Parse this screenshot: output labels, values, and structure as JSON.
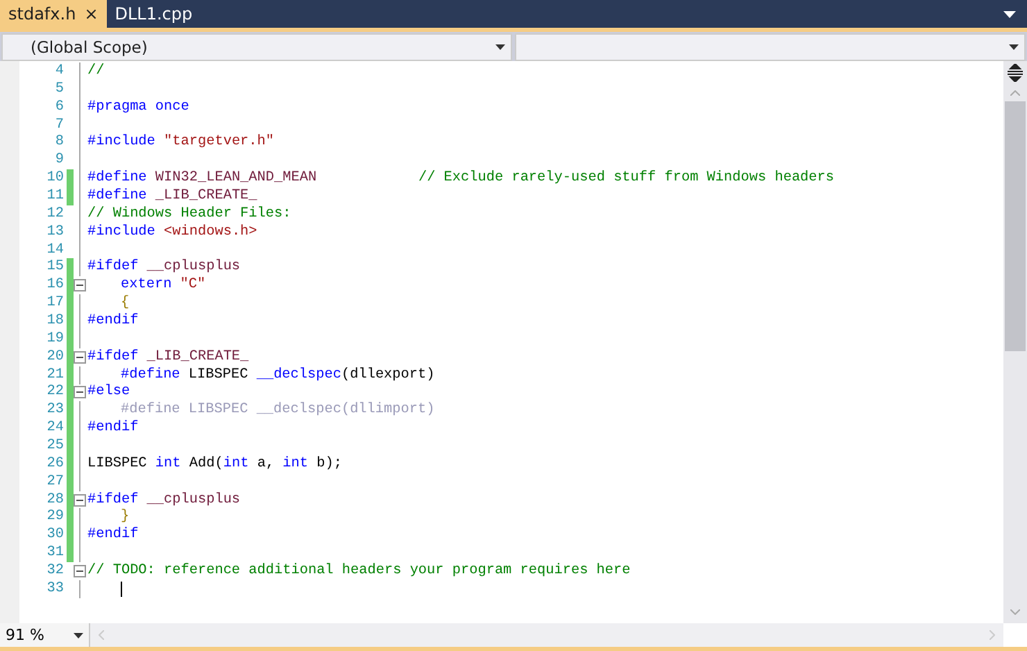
{
  "tabs": [
    {
      "label": "stdafx.h",
      "selected": true,
      "close": "×"
    },
    {
      "label": "DLL1.cpp",
      "selected": false
    }
  ],
  "navigation": {
    "scope": "(Global Scope)"
  },
  "lines": [
    {
      "number": "4",
      "changed": false,
      "collapsible": false,
      "tokens": [
        {
          "text": "//",
          "kind": "comment"
        }
      ]
    },
    {
      "number": "5",
      "changed": false,
      "collapsible": false
    },
    {
      "number": "6",
      "changed": false,
      "collapsible": false,
      "tokens": [
        {
          "text": "#pragma ",
          "kind": "preproc"
        },
        {
          "text": "once",
          "kind": "keyword"
        }
      ]
    },
    {
      "number": "7",
      "changed": false,
      "collapsible": false
    },
    {
      "number": "8",
      "changed": false,
      "collapsible": false,
      "tokens": [
        {
          "text": "#include ",
          "kind": "preproc"
        },
        {
          "text": "\"targetver.h\"",
          "kind": "string"
        }
      ]
    },
    {
      "number": "9",
      "changed": false,
      "collapsible": false
    },
    {
      "number": "10",
      "changed": true,
      "collapsible": false,
      "tokens": [
        {
          "text": "#define ",
          "kind": "preproc"
        },
        {
          "text": "WIN32_LEAN_AND_MEAN            ",
          "kind": "macro"
        },
        {
          "text": "// Exclude rarely-used stuff from Windows headers",
          "kind": "comment"
        }
      ]
    },
    {
      "number": "11",
      "changed": true,
      "collapsible": false,
      "tokens": [
        {
          "text": "#define ",
          "kind": "preproc"
        },
        {
          "text": "_LIB_CREATE_",
          "kind": "macro"
        }
      ]
    },
    {
      "number": "12",
      "changed": false,
      "collapsible": false,
      "tokens": [
        {
          "text": "// Windows Header Files:",
          "kind": "comment"
        }
      ]
    },
    {
      "number": "13",
      "changed": false,
      "collapsible": false,
      "tokens": [
        {
          "text": "#include ",
          "kind": "preproc"
        },
        {
          "text": "<windows.h>",
          "kind": "string"
        }
      ]
    },
    {
      "number": "14",
      "changed": false,
      "collapsible": false
    },
    {
      "number": "15",
      "changed": true,
      "collapsible": false,
      "tokens": [
        {
          "text": "#ifdef ",
          "kind": "preproc"
        },
        {
          "text": "__cplusplus",
          "kind": "macro"
        }
      ]
    },
    {
      "number": "16",
      "changed": true,
      "collapsible": true,
      "indented": true,
      "tokens": [
        {
          "text": "extern ",
          "kind": "keyword"
        },
        {
          "text": "\"C\"",
          "kind": "string"
        }
      ]
    },
    {
      "number": "17",
      "changed": true,
      "collapsible": false,
      "indented": true,
      "tokens": [
        {
          "text": "{",
          "kind": "brace"
        }
      ]
    },
    {
      "number": "18",
      "changed": true,
      "collapsible": false,
      "tokens": [
        {
          "text": "#endif",
          "kind": "preproc"
        }
      ]
    },
    {
      "number": "19",
      "changed": true,
      "collapsible": false
    },
    {
      "number": "20",
      "changed": true,
      "collapsible": true,
      "tokens": [
        {
          "text": "#ifdef ",
          "kind": "preproc"
        },
        {
          "text": "_LIB_CREATE_",
          "kind": "macro"
        }
      ]
    },
    {
      "number": "21",
      "changed": true,
      "collapsible": false,
      "indented": true,
      "tokens": [
        {
          "text": "#define ",
          "kind": "preproc"
        },
        {
          "text": "LIBSPEC ",
          "kind": "plain"
        },
        {
          "text": "__declspec",
          "kind": "keyword"
        },
        {
          "text": "(dllexport)",
          "kind": "plain"
        }
      ]
    },
    {
      "number": "22",
      "changed": true,
      "collapsible": true,
      "tokens": [
        {
          "text": "#else",
          "kind": "preproc"
        }
      ]
    },
    {
      "number": "23",
      "changed": true,
      "collapsible": false,
      "indented": true,
      "tokens": [
        {
          "text": "#define LIBSPEC __declspec(dllimport)",
          "kind": "inactive"
        }
      ]
    },
    {
      "number": "24",
      "changed": true,
      "collapsible": false,
      "tokens": [
        {
          "text": "#endif",
          "kind": "preproc"
        }
      ]
    },
    {
      "number": "25",
      "changed": true,
      "collapsible": false
    },
    {
      "number": "26",
      "changed": true,
      "collapsible": false,
      "tokens": [
        {
          "text": "LIBSPEC ",
          "kind": "plain"
        },
        {
          "text": "int ",
          "kind": "keyword"
        },
        {
          "text": "Add(",
          "kind": "plain"
        },
        {
          "text": "int ",
          "kind": "keyword"
        },
        {
          "text": "a, ",
          "kind": "plain"
        },
        {
          "text": "int ",
          "kind": "keyword"
        },
        {
          "text": "b);",
          "kind": "plain"
        }
      ]
    },
    {
      "number": "27",
      "changed": true,
      "collapsible": false
    },
    {
      "number": "28",
      "changed": true,
      "collapsible": true,
      "tokens": [
        {
          "text": "#ifdef ",
          "kind": "preproc"
        },
        {
          "text": "__cplusplus",
          "kind": "macro"
        }
      ]
    },
    {
      "number": "29",
      "changed": true,
      "collapsible": false,
      "indented": true,
      "tokens": [
        {
          "text": "}",
          "kind": "brace"
        }
      ]
    },
    {
      "number": "30",
      "changed": true,
      "collapsible": false,
      "tokens": [
        {
          "text": "#endif",
          "kind": "preproc"
        }
      ]
    },
    {
      "number": "31",
      "changed": true,
      "collapsible": false
    },
    {
      "number": "32",
      "changed": false,
      "collapsible": true,
      "tokens": [
        {
          "text": "// TODO: reference additional headers your program requires here",
          "kind": "comment"
        }
      ]
    },
    {
      "number": "33",
      "changed": false,
      "collapsible": false,
      "indented": true,
      "cursor": true
    }
  ],
  "zoom": "91 %"
}
